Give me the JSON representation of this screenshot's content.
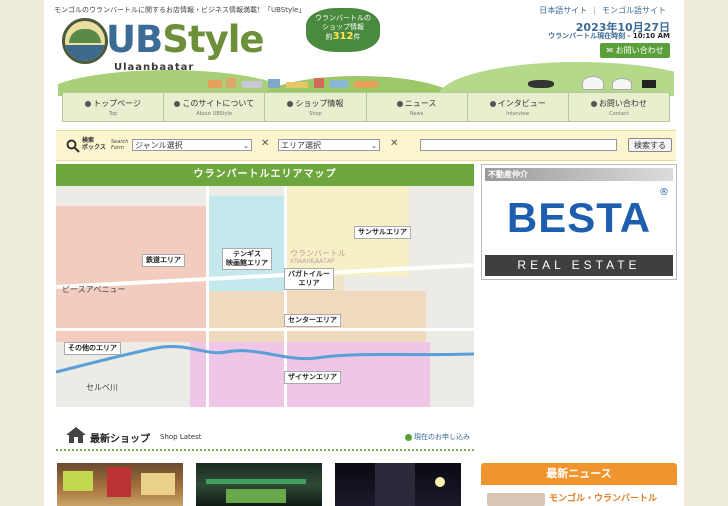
{
  "header": {
    "tagline": "モンゴルのウランバートルに関するお店情報・ビジネス情報満載！「UBStyle」",
    "logo": {
      "ub": "UB",
      "style": "Style",
      "sub": "Ulaanbaatar"
    },
    "shop_count": {
      "line1": "ウランバートルの",
      "line2": "ショップ情報",
      "prefix": "約",
      "count": "312",
      "suffix": "件"
    },
    "lang_links": [
      "日本語サイト",
      "モンゴル語サイト"
    ],
    "date": "2023年10月27日",
    "time_label": "ウランバートル現在時刻 - ",
    "time": "10:10 AM",
    "contact": "お問い合わせ"
  },
  "nav": [
    {
      "label": "トップページ",
      "en": "Top"
    },
    {
      "label": "このサイトについて",
      "en": "About UBStyle"
    },
    {
      "label": "ショップ情報",
      "en": "Shop"
    },
    {
      "label": "ニュース",
      "en": "News"
    },
    {
      "label": "インタビュー",
      "en": "Interview"
    },
    {
      "label": "お問い合わせ",
      "en": "Contact"
    }
  ],
  "search": {
    "label_line1": "検索",
    "label_line2": "ボックス",
    "label_en_line1": "Search",
    "label_en_line2": "Form",
    "genre": "ジャンル選択",
    "area": "エリア選択",
    "keyword": "",
    "times1": "✕",
    "times2": "✕",
    "button": "検索する"
  },
  "map": {
    "title": "ウランバートルエリアマップ",
    "labels": {
      "railway": "鉄道エリア",
      "tengis_1": "テンギス",
      "tengis_2": "映画館エリア",
      "sansar": "サンサルエリア",
      "bagatoiruu_1": "バガトイルー",
      "bagatoiruu_2": "エリア",
      "center": "センターエリア",
      "other": "その他のエリア",
      "zaisan": "ザイサンエリア"
    },
    "place_text": {
      "peace_avenue": "ピースアベニュー",
      "selbe_river": "セルベ川",
      "ub_jp": "ウランバートル",
      "ub_mn": "УЛААНБААТАР"
    }
  },
  "realestate": {
    "heading": "不動産仲介",
    "brand": "BESTA",
    "reg": "®",
    "tagline": "REAL ESTATE"
  },
  "latest": {
    "title": "最新ショップ",
    "title_en": "Shop Latest",
    "filter": "現在のお申し込み"
  },
  "news": {
    "heading": "最新ニュース",
    "first_title": "モンゴル・ウランバートル"
  },
  "colors": {
    "green": "#6ea63e",
    "blue": "#3c6b96",
    "orange": "#f0942e",
    "besta_blue": "#1d5fae"
  }
}
